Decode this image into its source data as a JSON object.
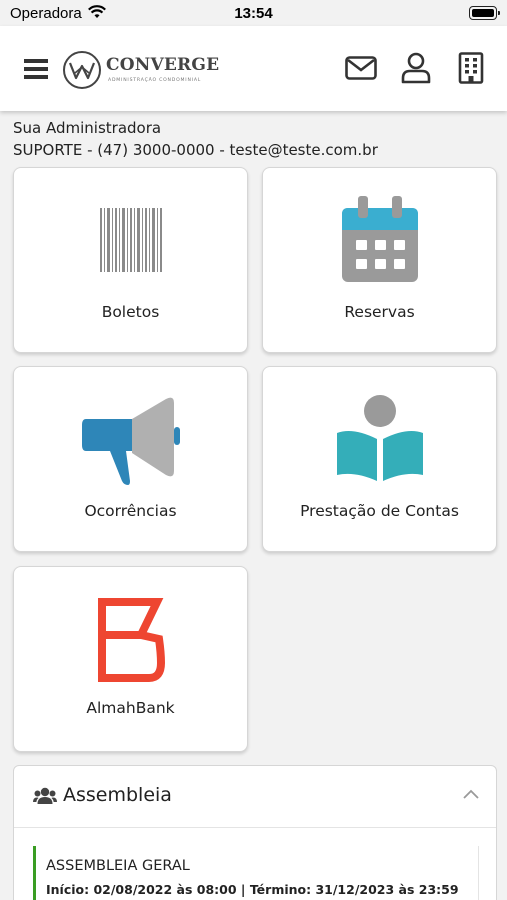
{
  "status_bar": {
    "carrier": "Operadora",
    "time": "13:54"
  },
  "header": {
    "logo_text": "CONVERGE",
    "logo_subtext": "ADMINISTRAÇÃO CONDOMINIAL",
    "icons": [
      "menu-icon",
      "mail-icon",
      "user-icon",
      "building-icon"
    ]
  },
  "admin": {
    "title": "Sua Administradora",
    "contact": "SUPORTE - (47) 3000-0000 - teste@teste.com.br"
  },
  "tiles": [
    {
      "label": "Boletos",
      "icon": "barcode-icon"
    },
    {
      "label": "Reservas",
      "icon": "calendar-icon"
    },
    {
      "label": "Ocorrências",
      "icon": "megaphone-icon"
    },
    {
      "label": "Prestação de Contas",
      "icon": "reading-book-icon"
    },
    {
      "label": "AlmahBank",
      "icon": "almahbank-logo"
    }
  ],
  "assembleia": {
    "title": "Assembleia",
    "icon": "people-icon",
    "item": {
      "title": "ASSEMBLEIA GERAL",
      "dates": "Início: 02/08/2022 às 08:00 | Término: 31/12/2023 às 23:59"
    }
  },
  "colors": {
    "calendar_header": "#3aaed0",
    "calendar_body": "#9a9a9a",
    "megaphone_blue": "#2e86b8",
    "book_teal": "#34aeb9",
    "almahbank_red": "#ee4631",
    "assembleia_accent": "#3a9d23"
  }
}
